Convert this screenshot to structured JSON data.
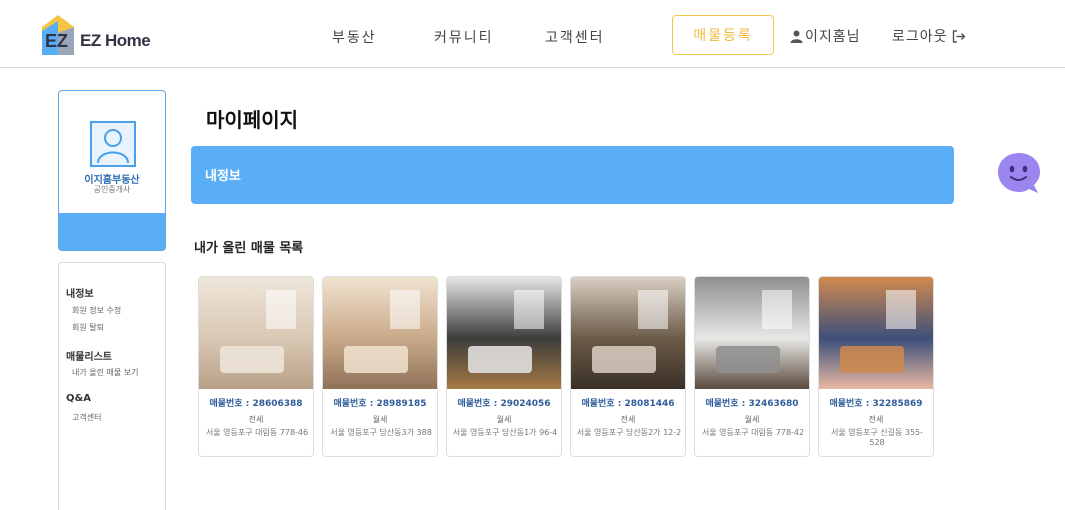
{
  "header": {
    "logo_text": "EZ Home",
    "nav": [
      "부동산",
      "커뮤니티",
      "고객센터"
    ],
    "register_button": "매물등록",
    "user_name": "이지홈님",
    "logout": "로그아웃"
  },
  "profile": {
    "name": "이지홈부동산",
    "role": "공인중개사"
  },
  "side_menu": {
    "sections": [
      {
        "title": "내정보",
        "items": [
          "회원 정보 수정",
          "회원 탈퇴"
        ]
      },
      {
        "title": "매물리스트",
        "items": [
          "내가 올린 매물 보기"
        ]
      },
      {
        "title": "Q&A",
        "items": [
          "고객센터"
        ]
      }
    ]
  },
  "main": {
    "page_title": "마이페이지",
    "banner_title": "내정보",
    "section_title": "내가 올린 매물 목록"
  },
  "listings": [
    {
      "number": "매물번호 : 28606388",
      "type": "전세",
      "address": "서울 영등포구 대림동 778-46",
      "colors": [
        "#d9c8b4",
        "#efe6da",
        "#b79f86"
      ]
    },
    {
      "number": "매물번호 : 28989185",
      "type": "월세",
      "address": "서울 영등포구 당산동3가 388",
      "colors": [
        "#c9a98a",
        "#f1e3cf",
        "#8e7258"
      ]
    },
    {
      "number": "매물번호 : 29024056",
      "type": "월세",
      "address": "서울 영등포구 당산동1가 96-4",
      "colors": [
        "#3c3c3c",
        "#e6e6e6",
        "#a77a45"
      ]
    },
    {
      "number": "매물번호 : 28081446",
      "type": "전세",
      "address": "서울 영등포구 당산동2가 12-2",
      "colors": [
        "#6b5a48",
        "#d9cfc2",
        "#3a3027"
      ]
    },
    {
      "number": "매물번호 : 32463680",
      "type": "월세",
      "address": "서울 영등포구 대림동 778-42",
      "colors": [
        "#e8e8e6",
        "#8f8f8f",
        "#5b4a3e"
      ]
    },
    {
      "number": "매물번호 : 32285869",
      "type": "전세",
      "address": "서울 영등포구 신길동 355-528",
      "colors": [
        "#3d4f7a",
        "#d08a4e",
        "#e9b8a2"
      ]
    }
  ],
  "colors": {
    "primary_blue": "#5aaef5",
    "accent_yellow": "#f0b93c",
    "chatbot_purple": "#9b86ef"
  }
}
